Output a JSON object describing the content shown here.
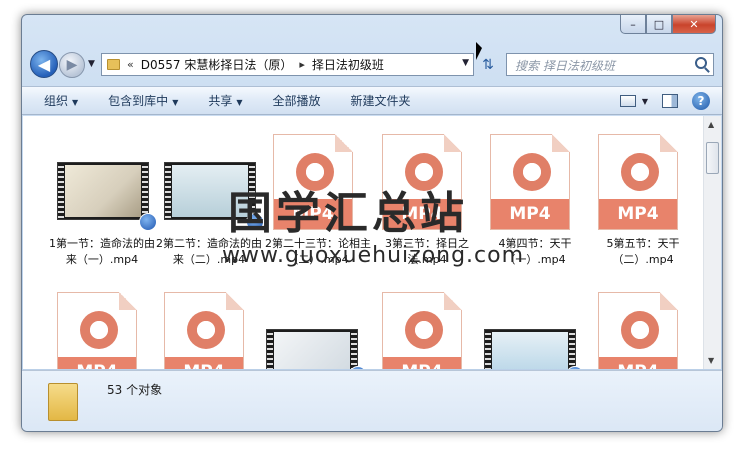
{
  "address": {
    "segments": [
      "D0557 宋慧彬择日法（原）",
      "择日法初级班"
    ]
  },
  "search": {
    "placeholder": "搜索 择日法初级班"
  },
  "toolbar": {
    "organize": "组织",
    "include": "包含到库中",
    "share": "共享",
    "play_all": "全部播放",
    "new_folder": "新建文件夹"
  },
  "files": [
    {
      "label": "1第一节：造命法的由来（一）.mp4",
      "kind": "video"
    },
    {
      "label": "2第二节：造命法的由来（二）.mp4",
      "kind": "video"
    },
    {
      "label": "2第二十三节：论相主（二）.mp4",
      "kind": "mp4"
    },
    {
      "label": "3第三节：择日之法.mp4",
      "kind": "mp4"
    },
    {
      "label": "4第四节：天干（一）.mp4",
      "kind": "mp4"
    },
    {
      "label": "5第五节：天干（二）.mp4",
      "kind": "mp4"
    },
    {
      "kind": "mp4"
    },
    {
      "kind": "mp4"
    },
    {
      "kind": "video"
    },
    {
      "kind": "mp4"
    },
    {
      "kind": "video"
    },
    {
      "kind": "mp4"
    }
  ],
  "mp4_badge": "MP4",
  "status": {
    "count": "53 个对象"
  },
  "watermark": {
    "title": "国学汇总站",
    "url": "www.guoxuehuizong.com"
  },
  "colors": {
    "mp4_accent": "#e8836b",
    "toolbar_text": "#1e395b"
  }
}
